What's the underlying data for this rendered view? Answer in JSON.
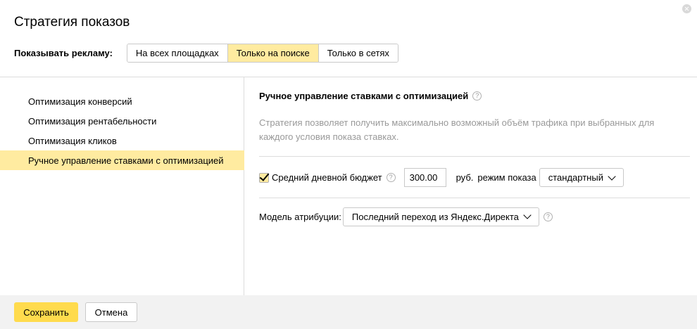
{
  "dialog": {
    "title": "Стратегия показов"
  },
  "show_ads": {
    "label": "Показывать рекламу:",
    "options": [
      "На всех площадках",
      "Только на поиске",
      "Только в сетях"
    ],
    "selected": "Только на поиске"
  },
  "sidebar": {
    "items": [
      {
        "label": "Оптимизация конверсий"
      },
      {
        "label": "Оптимизация рентабельности"
      },
      {
        "label": "Оптимизация кликов"
      },
      {
        "label": "Ручное управление ставками с оптимизацией"
      }
    ],
    "active": "Ручное управление ставками с оптимизацией"
  },
  "main": {
    "title": "Ручное управление ставками с оптимизацией",
    "help_glyph": "?",
    "description": "Стратегия позволяет получить максимально возможный объём трафика при выбранных для каждого условия показа ставках.",
    "budget": {
      "checked": true,
      "label": "Средний дневной бюджет",
      "value": "300.00",
      "currency": "руб.",
      "mode_label": "режим показа",
      "mode_value": "стандартный"
    },
    "attribution": {
      "label": "Модель атрибуции:",
      "value": "Последний переход из Яндекс.Директа"
    }
  },
  "footer": {
    "save_label": "Сохранить",
    "cancel_label": "Отмена"
  },
  "colors": {
    "accent": "#ffeba0",
    "save_button": "#ffdb4d",
    "footer_bg": "#f2f2f2"
  }
}
